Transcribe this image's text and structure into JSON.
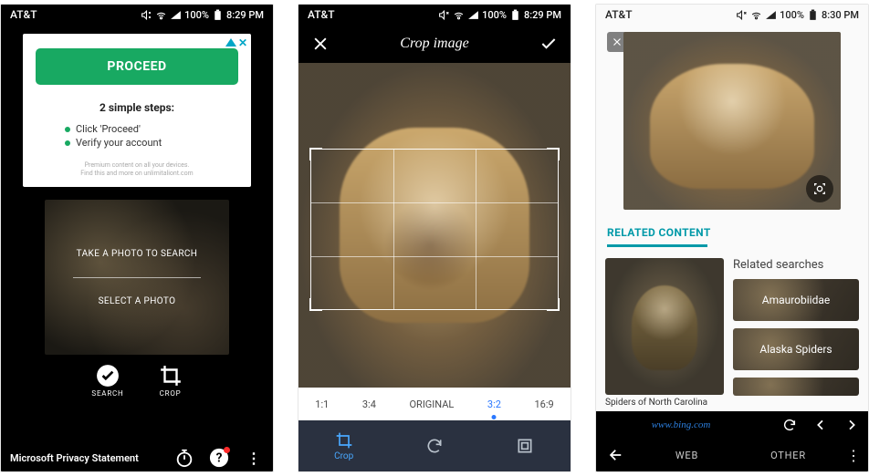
{
  "status_bar": {
    "carrier": "AT&T",
    "battery_pct": "100%",
    "time_s1": "8:29 PM",
    "time_s2": "8:29 PM",
    "time_s3": "8:30 PM"
  },
  "screen1": {
    "ad": {
      "proceed_label": "PROCEED",
      "steps_title": "2 simple steps:",
      "step1": "Click 'Proceed'",
      "step2": "Verify your account",
      "fine_line1": "Premium content on all your devices.",
      "fine_line2": "Find this and more on unlimitaliont.com"
    },
    "panel": {
      "take_photo_label": "TAKE A PHOTO TO SEARCH",
      "select_photo_label": "SELECT A PHOTO"
    },
    "tools": {
      "search_label": "SEARCH",
      "crop_label": "CROP"
    },
    "footer": {
      "privacy_label": "Microsoft Privacy Statement"
    }
  },
  "screen2": {
    "title": "Crop image",
    "ratios": {
      "r1": "1:1",
      "r2": "3:4",
      "r3": "ORIGINAL",
      "r4": "3:2",
      "r5": "16:9",
      "active": "3:2"
    },
    "toolbar": {
      "crop_label": "Crop"
    }
  },
  "screen3": {
    "related_tab": "RELATED CONTENT",
    "thumb_caption": "Spiders of North Carolina",
    "related_title": "Related searches",
    "chips": {
      "c1": "Amaurobiidae",
      "c2": "Alaska Spiders"
    },
    "url": "www.bing.com",
    "tabs": {
      "web": "WEB",
      "other": "OTHER"
    }
  }
}
